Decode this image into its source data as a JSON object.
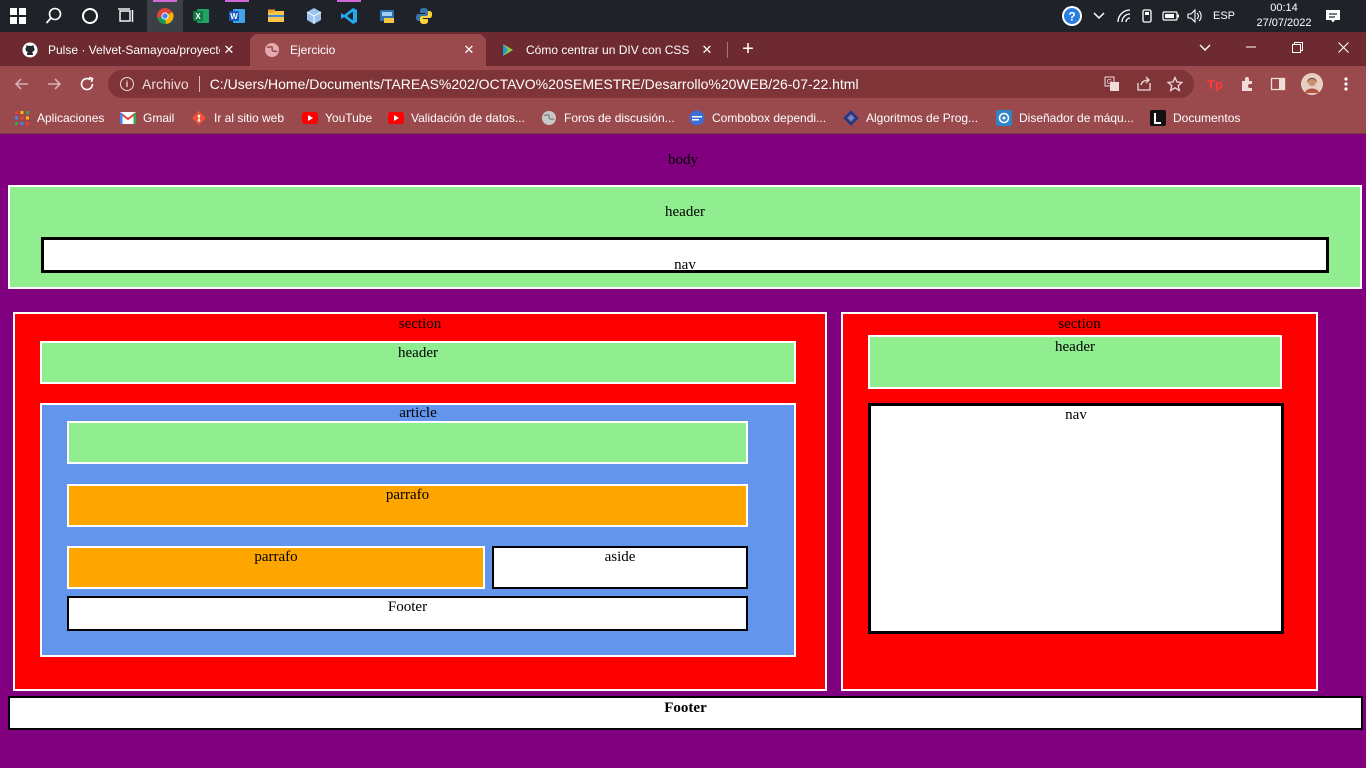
{
  "taskbar": {
    "apps": [
      {
        "icon": "windows-start-icon"
      },
      {
        "icon": "search-icon"
      },
      {
        "icon": "cortana-icon"
      },
      {
        "icon": "task-view-icon"
      },
      {
        "icon": "chrome-icon"
      },
      {
        "icon": "excel-icon"
      },
      {
        "icon": "word-icon"
      },
      {
        "icon": "file-explorer-icon"
      },
      {
        "icon": "virtualbox-icon"
      },
      {
        "icon": "vscode-icon"
      },
      {
        "icon": "app-icon"
      },
      {
        "icon": "python-icon"
      }
    ],
    "tray": {
      "language": "ESP",
      "time": "00:14",
      "date": "27/07/2022"
    }
  },
  "browser": {
    "tabs": [
      {
        "title": "Pulse · Velvet-Samayoa/proyecto",
        "icon": "github-icon",
        "active": false
      },
      {
        "title": "Ejercicio",
        "icon": "globe-icon",
        "active": true
      },
      {
        "title": "Cómo centrar un DIV con CSS",
        "icon": "platzi-icon",
        "active": false
      }
    ],
    "new_tab": "+",
    "address": {
      "scheme_label": "Archivo",
      "url": "C:/Users/Home/Documents/TAREAS%202/OCTAVO%20SEMESTRE/Desarrollo%20WEB/26-07-22.html"
    },
    "bookmarks": [
      {
        "label": "Aplicaciones",
        "icon": "apps-grid-icon"
      },
      {
        "label": "Gmail",
        "icon": "gmail-icon"
      },
      {
        "label": "Ir al sitio web",
        "icon": "git-icon"
      },
      {
        "label": "YouTube",
        "icon": "youtube-icon"
      },
      {
        "label": "Validación de datos...",
        "icon": "youtube-icon"
      },
      {
        "label": "Foros de discusión...",
        "icon": "globe-icon"
      },
      {
        "label": "Combobox dependi...",
        "icon": "site-icon"
      },
      {
        "label": "Algoritmos de Prog...",
        "icon": "site-icon"
      },
      {
        "label": "Diseñador de máqu...",
        "icon": "site-icon"
      },
      {
        "label": "Documentos",
        "icon": "docs-icon"
      }
    ]
  },
  "page": {
    "body_label": "body",
    "header_label": "header",
    "nav_label": "nav",
    "left_section": {
      "label": "section",
      "header_label": "header",
      "article_label": "article",
      "paragraph_1": "parrafo",
      "paragraph_2": "parrafo",
      "aside_label": "aside",
      "footer_label": "Footer"
    },
    "right_section": {
      "label": "section",
      "header_label": "header",
      "nav_label": "nav"
    },
    "footer_label": "Footer"
  },
  "colors": {
    "body": "#800080",
    "header": "#90ee90",
    "section": "#ff0000",
    "article": "#6495ed",
    "paragraph": "#ffa500",
    "white": "#ffffff"
  }
}
